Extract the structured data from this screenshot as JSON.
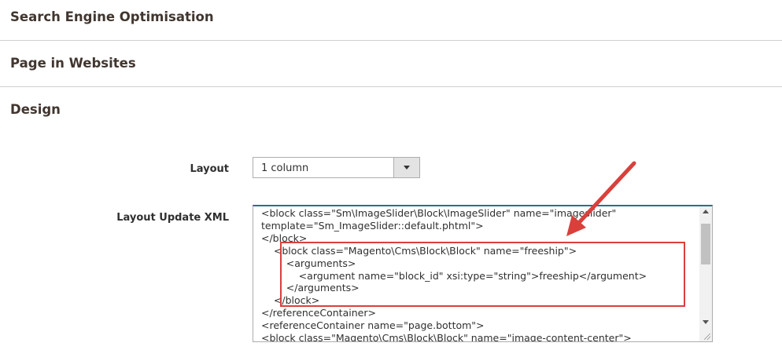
{
  "sections": [
    {
      "title": "Search Engine Optimisation"
    },
    {
      "title": "Page in Websites"
    },
    {
      "title": "Design"
    }
  ],
  "form": {
    "layout_label": "Layout",
    "layout_value": "1 column",
    "xml_label": "Layout Update XML",
    "xml_lines": [
      "<block class=\"Sm\\ImageSlider\\Block\\ImageSlider\" name=\"imageslider\"",
      "template=\"Sm_ImageSlider::default.phtml\">",
      "</block>",
      "    <block class=\"Magento\\Cms\\Block\\Block\" name=\"freeship\">",
      "        <arguments>",
      "            <argument name=\"block_id\" xsi:type=\"string\">freeship</argument>",
      "        </arguments>",
      "    </block>",
      "</referenceContainer>",
      "<referenceContainer name=\"page.bottom\">",
      "<block class=\"Magento\\Cms\\Block\\Block\" name=\"image-content-center\">"
    ]
  },
  "annotation": {
    "color": "#d9403c"
  }
}
